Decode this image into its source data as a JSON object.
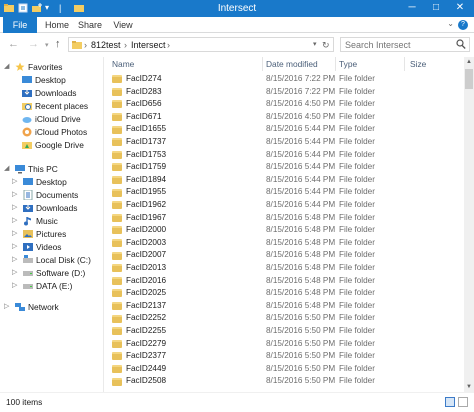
{
  "window": {
    "title": "Intersect"
  },
  "ribbon": {
    "tabs": [
      "File",
      "Home",
      "Share",
      "View"
    ],
    "help": "?"
  },
  "address": {
    "crumbs": [
      "812test",
      "Intersect"
    ],
    "search_placeholder": "Search Intersect"
  },
  "nav": {
    "favorites_label": "Favorites",
    "favorites": [
      "Desktop",
      "Downloads",
      "Recent places",
      "iCloud Drive",
      "iCloud Photos",
      "Google Drive"
    ],
    "thispc_label": "This PC",
    "thispc": [
      "Desktop",
      "Documents",
      "Downloads",
      "Music",
      "Pictures",
      "Videos",
      "Local Disk (C:)",
      "Software (D:)",
      "DATA (E:)"
    ],
    "network_label": "Network"
  },
  "columns": {
    "name": "Name",
    "date": "Date modified",
    "type": "Type",
    "size": "Size"
  },
  "files": [
    {
      "name": "FacID274",
      "date": "8/15/2016 7:22 PM",
      "type": "File folder"
    },
    {
      "name": "FacID283",
      "date": "8/15/2016 7:22 PM",
      "type": "File folder"
    },
    {
      "name": "FacID656",
      "date": "8/15/2016 4:50 PM",
      "type": "File folder"
    },
    {
      "name": "FacID671",
      "date": "8/15/2016 4:50 PM",
      "type": "File folder"
    },
    {
      "name": "FacID1655",
      "date": "8/15/2016 5:44 PM",
      "type": "File folder"
    },
    {
      "name": "FacID1737",
      "date": "8/15/2016 5:44 PM",
      "type": "File folder"
    },
    {
      "name": "FacID1753",
      "date": "8/15/2016 5:44 PM",
      "type": "File folder"
    },
    {
      "name": "FacID1759",
      "date": "8/15/2016 5:44 PM",
      "type": "File folder"
    },
    {
      "name": "FacID1894",
      "date": "8/15/2016 5:44 PM",
      "type": "File folder"
    },
    {
      "name": "FacID1955",
      "date": "8/15/2016 5:44 PM",
      "type": "File folder"
    },
    {
      "name": "FacID1962",
      "date": "8/15/2016 5:44 PM",
      "type": "File folder"
    },
    {
      "name": "FacID1967",
      "date": "8/15/2016 5:48 PM",
      "type": "File folder"
    },
    {
      "name": "FacID2000",
      "date": "8/15/2016 5:48 PM",
      "type": "File folder"
    },
    {
      "name": "FacID2003",
      "date": "8/15/2016 5:48 PM",
      "type": "File folder"
    },
    {
      "name": "FacID2007",
      "date": "8/15/2016 5:48 PM",
      "type": "File folder"
    },
    {
      "name": "FacID2013",
      "date": "8/15/2016 5:48 PM",
      "type": "File folder"
    },
    {
      "name": "FacID2016",
      "date": "8/15/2016 5:48 PM",
      "type": "File folder"
    },
    {
      "name": "FacID2025",
      "date": "8/15/2016 5:48 PM",
      "type": "File folder"
    },
    {
      "name": "FacID2137",
      "date": "8/15/2016 5:48 PM",
      "type": "File folder"
    },
    {
      "name": "FacID2252",
      "date": "8/15/2016 5:50 PM",
      "type": "File folder"
    },
    {
      "name": "FacID2255",
      "date": "8/15/2016 5:50 PM",
      "type": "File folder"
    },
    {
      "name": "FacID2279",
      "date": "8/15/2016 5:50 PM",
      "type": "File folder"
    },
    {
      "name": "FacID2377",
      "date": "8/15/2016 5:50 PM",
      "type": "File folder"
    },
    {
      "name": "FacID2449",
      "date": "8/15/2016 5:50 PM",
      "type": "File folder"
    },
    {
      "name": "FacID2508",
      "date": "8/15/2016 5:50 PM",
      "type": "File folder"
    }
  ],
  "status": {
    "count": "100 items"
  }
}
